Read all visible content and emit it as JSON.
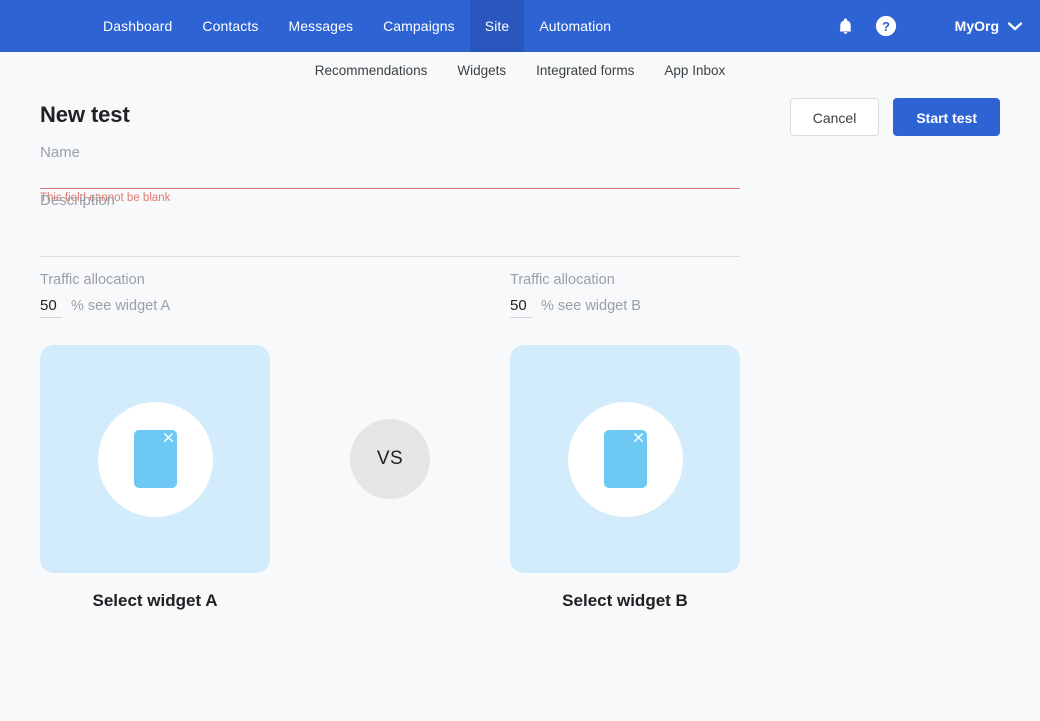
{
  "topnav": {
    "items": [
      {
        "label": "Dashboard",
        "active": false
      },
      {
        "label": "Contacts",
        "active": false
      },
      {
        "label": "Messages",
        "active": false
      },
      {
        "label": "Campaigns",
        "active": false
      },
      {
        "label": "Site",
        "active": true
      },
      {
        "label": "Automation",
        "active": false
      }
    ],
    "notifications_icon": "bell-icon",
    "help_icon": "help-icon",
    "org_name": "MyOrg",
    "org_caret_icon": "chevron-down-icon",
    "background_color": "#2e63d4",
    "active_background_color": "#2a57bd"
  },
  "subnav": {
    "items": [
      {
        "label": "Recommendations"
      },
      {
        "label": "Widgets"
      },
      {
        "label": "Integrated forms"
      },
      {
        "label": "App Inbox"
      }
    ]
  },
  "page": {
    "title": "New test",
    "cancel_label": "Cancel",
    "start_label": "Start test",
    "primary_color": "#2e63d4"
  },
  "form": {
    "name": {
      "placeholder": "Name",
      "value": "",
      "error": "This field cannot be blank",
      "error_color": "#e07b71"
    },
    "description": {
      "placeholder": "Description",
      "value": ""
    }
  },
  "allocation": [
    {
      "label": "Traffic allocation",
      "value": "50",
      "suffix": "% see widget A"
    },
    {
      "label": "Traffic allocation",
      "value": "50",
      "suffix": "% see widget B"
    }
  ],
  "widgets": {
    "vs_label": "VS",
    "card_color": "#d2ecfb",
    "glyph_color": "#6dc9f4",
    "a": {
      "caption": "Select widget A",
      "glyph_icon": "widget-placeholder-icon",
      "close_icon": "close-icon"
    },
    "b": {
      "caption": "Select widget B",
      "glyph_icon": "widget-placeholder-icon",
      "close_icon": "close-icon"
    }
  }
}
